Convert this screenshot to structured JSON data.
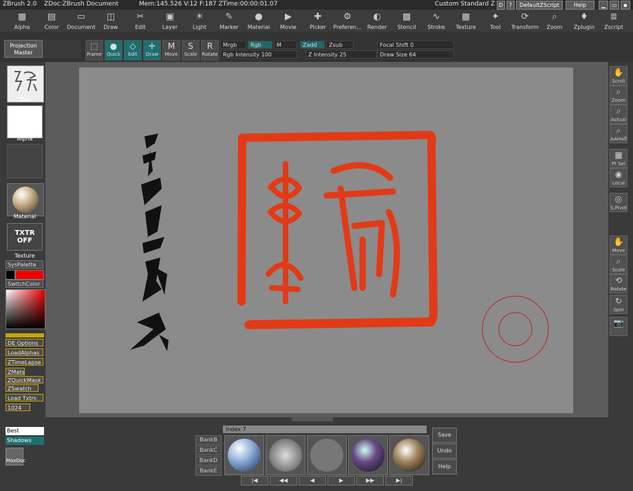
{
  "titlebar": {
    "app": "ZBrush 2.0",
    "doc": "ZDoc:ZBrush Document",
    "stats": "Mem:145.526  V:12  F:187  ZTime:00:00:01.07",
    "layout": "Custom Standard Z",
    "script": "DefaultZScript",
    "help": "Help",
    "d_btn": "D",
    "q_btn": "?"
  },
  "menu": [
    {
      "label": "Alpha",
      "icon": "alpha-icon",
      "glyph": "▦"
    },
    {
      "label": "Color",
      "icon": "color-icon",
      "glyph": "▤"
    },
    {
      "label": "Document",
      "icon": "document-icon",
      "glyph": "▭"
    },
    {
      "label": "Draw",
      "icon": "draw-icon",
      "glyph": "◫"
    },
    {
      "label": "Edit",
      "icon": "edit-icon",
      "glyph": "✂"
    },
    {
      "label": "Layer",
      "icon": "layer-icon",
      "glyph": "▣"
    },
    {
      "label": "Light",
      "icon": "light-icon",
      "glyph": "☀"
    },
    {
      "label": "Marker",
      "icon": "marker-icon",
      "glyph": "✎"
    },
    {
      "label": "Material",
      "icon": "material-icon",
      "glyph": "●"
    },
    {
      "label": "Movie",
      "icon": "movie-icon",
      "glyph": "▶"
    },
    {
      "label": "Picker",
      "icon": "picker-icon",
      "glyph": "✚"
    },
    {
      "label": "Preferen...",
      "icon": "preferences-icon",
      "glyph": "⚙"
    },
    {
      "label": "Render",
      "icon": "render-icon",
      "glyph": "◐"
    },
    {
      "label": "Stencil",
      "icon": "stencil-icon",
      "glyph": "▩"
    },
    {
      "label": "Stroke",
      "icon": "stroke-icon",
      "glyph": "∿"
    },
    {
      "label": "Texture",
      "icon": "texture-icon",
      "glyph": "▦"
    },
    {
      "label": "Tool",
      "icon": "tool-icon",
      "glyph": "✦"
    },
    {
      "label": "Transform",
      "icon": "transform-icon",
      "glyph": "⟳"
    },
    {
      "label": "Zoom",
      "icon": "zoom-icon",
      "glyph": "⌕"
    },
    {
      "label": "Zplugin",
      "icon": "zplugin-icon",
      "glyph": "♦"
    },
    {
      "label": "Zscript",
      "icon": "zscript-icon",
      "glyph": "≣"
    }
  ],
  "toolbar": {
    "projection_master": "Projection Master",
    "buttons": [
      {
        "label": "Frame",
        "icon": "frame-icon",
        "glyph": "⬚"
      },
      {
        "label": "Quick",
        "icon": "quick-icon",
        "glyph": "●"
      },
      {
        "label": "Edit",
        "icon": "edit-mode-icon",
        "glyph": "◇"
      },
      {
        "label": "Draw",
        "icon": "draw-mode-icon",
        "glyph": "✛"
      },
      {
        "label": "Move",
        "icon": "move-icon",
        "glyph": "M"
      },
      {
        "label": "Scale",
        "icon": "scale-icon",
        "glyph": "S"
      },
      {
        "label": "Rotate",
        "icon": "rotate-icon",
        "glyph": "R"
      }
    ],
    "mrgb": "Mrgb",
    "rgb": "Rgb",
    "m": "M",
    "zadd": "Zadd",
    "zsub": "Zsub",
    "rgb_intensity": "Rgb Intensity 100",
    "z_intensity": "Z Intensity 25",
    "focal_shift": "Focal Shift 0",
    "draw_size": "Draw Size 64"
  },
  "left": {
    "tool": "Tool",
    "alpha": "Alpha",
    "material": "Material",
    "txtr_off": "TXTR OFF",
    "texture": "Texture",
    "syspalette": "SysPalette",
    "switchcolor": "SwitchColor",
    "buttons": [
      "DE Options",
      "LoadAlphas",
      "ZTimeLapse",
      "ZMats",
      "ZQuickMask",
      "ZSwatch",
      "Load Txtrs",
      "1024"
    ],
    "best": "Best",
    "shadows": "Shadows",
    "maxdoc": "MaxDoc"
  },
  "right": [
    {
      "label": "Scroll",
      "icon": "scroll-icon",
      "glyph": "✋"
    },
    {
      "label": "Zoom",
      "icon": "zoom-view-icon",
      "glyph": "⌕"
    },
    {
      "label": "Actual",
      "icon": "actual-icon",
      "glyph": "⌕"
    },
    {
      "label": "AAHalf",
      "icon": "aahalf-icon",
      "glyph": "⌕"
    },
    {
      "label": "Pt Sel",
      "icon": "ptsel-icon",
      "glyph": "▦"
    },
    {
      "label": "Local",
      "icon": "local-icon",
      "glyph": "◉"
    },
    {
      "label": "S.Pivot",
      "icon": "spivot-icon",
      "glyph": "◎"
    },
    {
      "label": "Move",
      "icon": "move-view-icon",
      "glyph": "✋"
    },
    {
      "label": "Scale",
      "icon": "scale-view-icon",
      "glyph": "⌕"
    },
    {
      "label": "Rotate",
      "icon": "rotate-view-icon",
      "glyph": "⟲"
    },
    {
      "label": "Spin",
      "icon": "spin-icon",
      "glyph": "↻"
    },
    {
      "label": "",
      "icon": "camera-icon",
      "glyph": "📷"
    }
  ],
  "bottom": {
    "index": "Index 7",
    "banks": [
      "BankB",
      "BankC",
      "BankD",
      "BankE"
    ],
    "save": "Save",
    "undo": "Undo",
    "help": "Help",
    "nav": [
      "|◀",
      "◀◀",
      "◀",
      "▶",
      "▶▶",
      "▶|"
    ]
  },
  "colors": {
    "accent_teal": "#1e6f6f",
    "seal_red": "#e23a16",
    "highlight_yellow": "#c9a400"
  }
}
